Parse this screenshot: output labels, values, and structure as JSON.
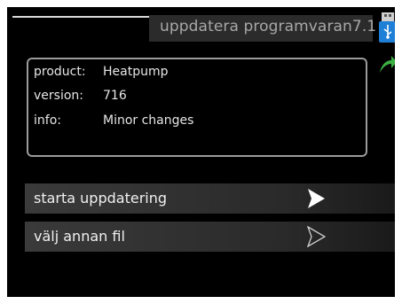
{
  "header": {
    "title": "uppdatera programvaran7.1"
  },
  "info": {
    "product_label": "product:",
    "product_value": "Heatpump",
    "version_label": "version:",
    "version_value": "716",
    "info_label": "info:",
    "info_value": "Minor changes"
  },
  "menu": {
    "items": [
      {
        "label": "starta uppdatering"
      },
      {
        "label": "välj annan fil"
      }
    ]
  },
  "icons": {
    "top_right": "usb-stick-icon",
    "return": "return-arrow-icon"
  },
  "colors": {
    "background": "#000000",
    "title_bar": "#2b2b2b",
    "return_arrow": "#3cb043"
  }
}
